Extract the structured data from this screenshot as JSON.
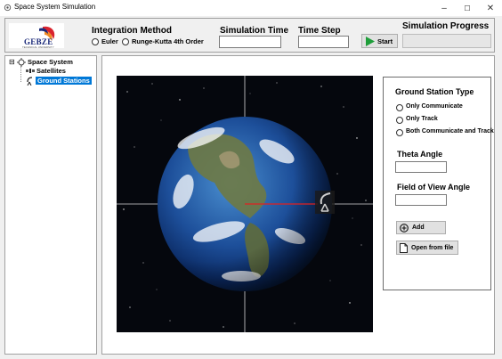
{
  "window": {
    "title": "Space System Simulation",
    "minimize": "–",
    "maximize": "☐",
    "close": "✕"
  },
  "logo": {
    "name": "GEBZE",
    "subtitle": "TECHNICAL UNIVERSITY"
  },
  "integration": {
    "label": "Integration Method",
    "options": [
      "Euler",
      "Runge-Kutta 4th Order"
    ]
  },
  "simulation_time": {
    "label": "Simulation Time",
    "value": ""
  },
  "time_step": {
    "label": "Time Step",
    "value": ""
  },
  "start_button": {
    "label": "Start"
  },
  "progress": {
    "label": "Simulation Progress",
    "value": 0
  },
  "tree": {
    "root": "Space System",
    "toggle": "⊟",
    "children": [
      "Satellites",
      "Ground Stations"
    ],
    "selected": "Ground Stations"
  },
  "ground_station": {
    "type_label": "Ground Station Type",
    "options": [
      "Only Communicate",
      "Only Track",
      "Both Communicate and Track"
    ],
    "theta_label": "Theta Angle",
    "theta_value": "",
    "fov_label": "Field of View Angle",
    "fov_value": "",
    "add_label": "Add",
    "open_label": "Open from file"
  },
  "colors": {
    "selection": "#0078d7",
    "start_arrow": "#1f9e3a",
    "space": "#05070d",
    "beam": "#e02020"
  }
}
